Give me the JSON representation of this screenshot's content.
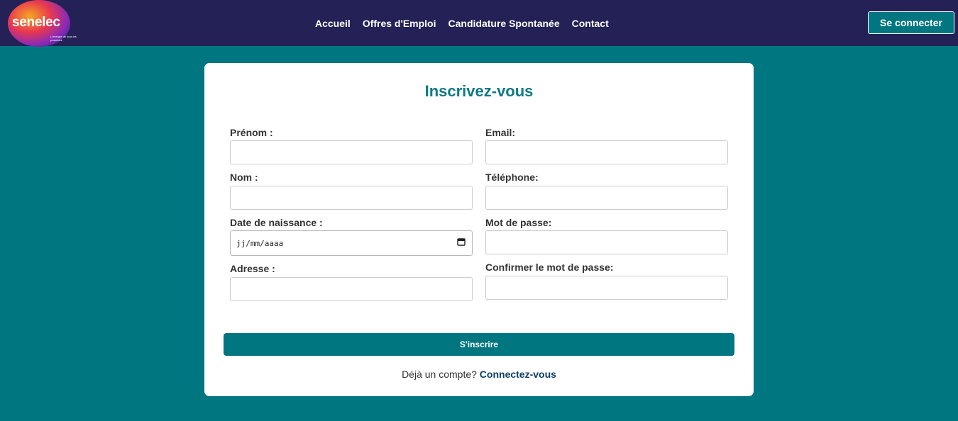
{
  "brand": {
    "name": "senelec",
    "tagline": "L'énergie de tous les possibles"
  },
  "nav": {
    "links": [
      "Accueil",
      "Offres d'Emploi",
      "Candidature Spontanée",
      "Contact"
    ],
    "login_label": "Se connecter"
  },
  "form": {
    "title": "Inscrivez-vous",
    "left_fields": [
      {
        "label": "Prénom :",
        "value": ""
      },
      {
        "label": "Nom :",
        "value": ""
      },
      {
        "label": "Date de naissance :",
        "placeholder": "jj/mm/aaaa"
      },
      {
        "label": "Adresse :",
        "value": ""
      }
    ],
    "right_fields": [
      {
        "label": "Email:",
        "value": ""
      },
      {
        "label": "Téléphone:",
        "value": ""
      },
      {
        "label": "Mot de passe:",
        "value": ""
      },
      {
        "label": "Confirmer le mot de passe:",
        "value": ""
      }
    ],
    "submit_label": "S'inscrire",
    "signin_prompt": "Déjà un compte?",
    "signin_link": "Connectez-vous"
  },
  "colors": {
    "navbar": "#232155",
    "accent": "#007681",
    "title": "#0d7a86",
    "link": "#0c3e6a"
  },
  "icons": {
    "calendar": "calendar-icon"
  }
}
